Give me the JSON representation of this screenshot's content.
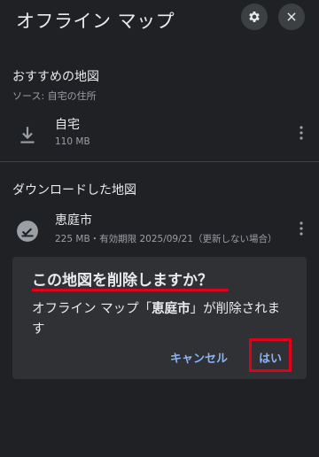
{
  "header": {
    "title": "オフライン マップ",
    "settings_icon": "gear-icon",
    "close_icon": "close-icon"
  },
  "recommended": {
    "title": "おすすめの地図",
    "source": "ソース: 自宅の住所",
    "item": {
      "name": "自宅",
      "size": "110 MB",
      "icon": "download-icon"
    }
  },
  "downloaded": {
    "title": "ダウンロードした地図",
    "item": {
      "name": "恵庭市",
      "meta": "225 MB・有効期限 2025/09/21（更新しない場合）",
      "icon": "check-circle-icon"
    }
  },
  "dialog": {
    "title": "この地図を削除しますか？",
    "message_prefix": "オフライン マップ「",
    "message_name": "恵庭市",
    "message_suffix": "」が削除されます",
    "cancel_label": "キャンセル",
    "confirm_label": "はい"
  },
  "colors": {
    "background": "#202124",
    "dialog": "#303134",
    "accent": "#8ab4f8",
    "highlight": "#e0001b"
  }
}
